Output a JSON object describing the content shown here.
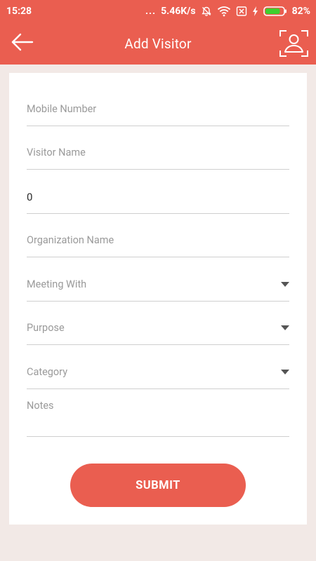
{
  "status_bar": {
    "time": "15:28",
    "dots": "...",
    "network_speed": "5.46K/s",
    "battery_percent": "82%",
    "battery_level": 0.82,
    "icons": [
      "mute-bell-icon",
      "wifi-icon",
      "no-sim-icon",
      "charging-bolt-icon",
      "battery-icon"
    ]
  },
  "app_bar": {
    "title": "Add Visitor",
    "back_icon": "arrow-left-icon",
    "scan_icon": "face-scan-icon"
  },
  "form": {
    "mobile_placeholder": "Mobile Number",
    "visitor_name_placeholder": "Visitor Name",
    "visitor_count_value": "0",
    "organization_placeholder": "Organization Name",
    "meeting_with_placeholder": "Meeting With",
    "purpose_placeholder": "Purpose",
    "category_placeholder": "Category",
    "notes_placeholder": "Notes",
    "submit_label": "SUBMIT"
  },
  "colors": {
    "primary": "#ea5e50",
    "background": "#f2e9e6",
    "card": "#ffffff",
    "divider": "#cfcfcf",
    "placeholder": "#9a9a9a"
  }
}
